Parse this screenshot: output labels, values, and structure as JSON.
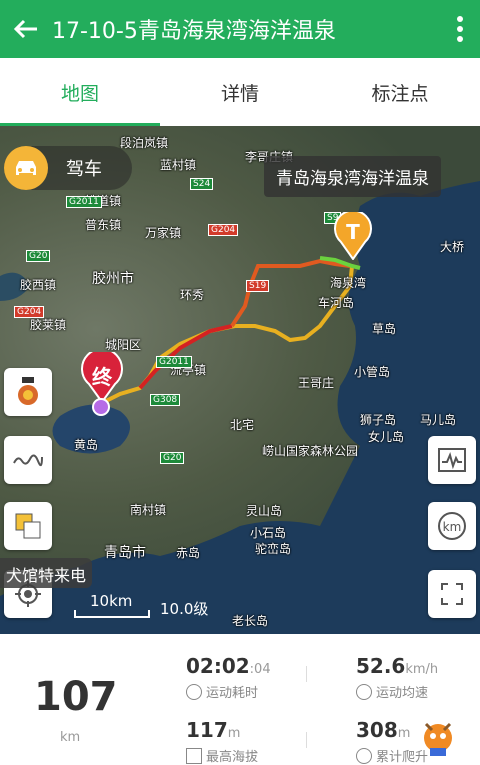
{
  "header": {
    "title": "17-10-5青岛海泉湾海洋温泉",
    "back_icon": "back-arrow-icon",
    "menu_icon": "more-vert-icon"
  },
  "tabs": [
    {
      "label": "地图",
      "active": true
    },
    {
      "label": "详情",
      "active": false
    },
    {
      "label": "标注点",
      "active": false
    }
  ],
  "map": {
    "mode_label": "驾车",
    "callout": "青岛海泉湾海洋温泉",
    "start_marker": "T",
    "end_marker": "终",
    "scale": "10km",
    "zoom": "10.0级",
    "toast": "犬馆特来电",
    "places": {
      "duanjiabu": "段泊岚镇",
      "lanshi": "蓝村镇",
      "lijia": "李哥庄镇",
      "tiedao": "铁道镇",
      "jiaozhou": "胶州市",
      "pusan": "普东镇",
      "wanjia": "万家镇",
      "jiaoxi": "胶西镇",
      "jiaolai": "胶莱镇",
      "lijiazhuang": "流亭镇",
      "jihong": "环秀",
      "chengyang": "城阳区",
      "nancun": "南村镇",
      "huangdao": "黄岛",
      "qingdao": "青岛市",
      "chizao": "赤岛",
      "caodao": "草岛",
      "xiaoguandao": "小管岛",
      "shizidao": "狮子岛",
      "nvdao": "女儿岛",
      "maer": "马儿岛",
      "laoshan": "崂山国家森林公园",
      "beizhai": "北宅",
      "wangge": "王哥庄",
      "dagu": "大桥",
      "lingshan": "灵山岛",
      "xiaoshi": "小石岛",
      "tuoshan": "驼峦岛",
      "laochang": "老长岛",
      "chehe": "车河岛",
      "haiquan": "海泉湾"
    },
    "roads": {
      "s24": "S24",
      "g2011a": "G2011",
      "g204a": "G204",
      "g20a": "G20",
      "g204b": "G204",
      "s19": "S19",
      "g2011b": "G2011",
      "g308": "G308",
      "g20b": "G20",
      "s9": "S9"
    }
  },
  "stats": {
    "distance_value": "107",
    "distance_unit": "km",
    "duration_value": "02:02",
    "duration_seconds": ":04",
    "duration_label": "运动耗时",
    "speed_value": "52.6",
    "speed_unit": "km/h",
    "speed_label": "运动均速",
    "altitude_value": "117",
    "altitude_unit": "m",
    "altitude_label": "最高海拔",
    "climb_value": "308",
    "climb_unit": "m",
    "climb_label": "累计爬升"
  },
  "colors": {
    "primary": "#23ad5c",
    "orange": "#f4b538",
    "red_marker": "#d8223a"
  }
}
